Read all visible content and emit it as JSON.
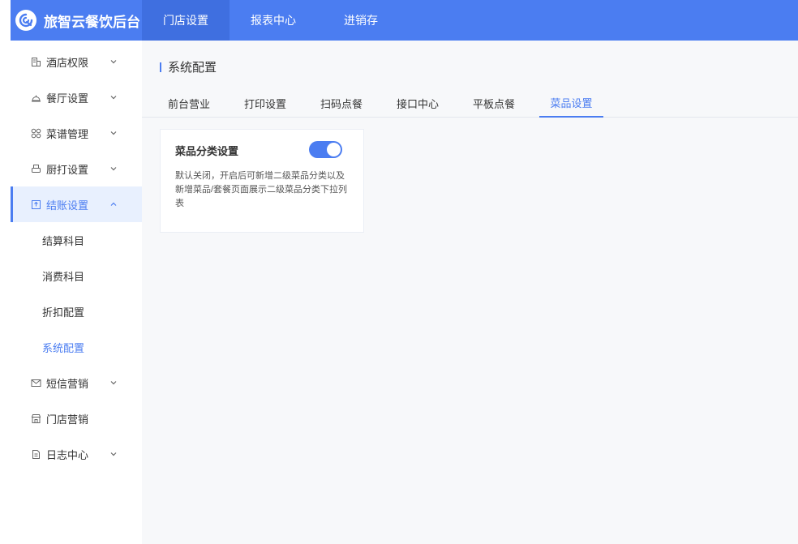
{
  "brand": {
    "name": "旅智云餐饮后台",
    "logo_icon": "swirl-logo"
  },
  "colors": {
    "primary": "#4b7df1",
    "primary_dark": "#3f6fe0",
    "sidebar_active_bg": "#e8f0fe",
    "content_bg": "#f7f8fa"
  },
  "topnav": [
    {
      "label": "门店设置",
      "active": true
    },
    {
      "label": "报表中心",
      "active": false
    },
    {
      "label": "进销存",
      "active": false
    }
  ],
  "sidebar": {
    "items": [
      {
        "label": "酒店权限",
        "icon": "building-icon",
        "expandable": true
      },
      {
        "label": "餐厅设置",
        "icon": "cloche-icon",
        "expandable": true
      },
      {
        "label": "菜谱管理",
        "icon": "grid-icon",
        "expandable": true
      },
      {
        "label": "厨打设置",
        "icon": "printer-icon",
        "expandable": true
      },
      {
        "label": "结账设置",
        "icon": "receipt-icon",
        "expandable": true,
        "open": true,
        "children": [
          {
            "label": "结算科目",
            "active": false
          },
          {
            "label": "消费科目",
            "active": false
          },
          {
            "label": "折扣配置",
            "active": false
          },
          {
            "label": "系统配置",
            "active": true
          }
        ]
      },
      {
        "label": "短信营销",
        "icon": "mail-icon",
        "expandable": true
      },
      {
        "label": "门店营销",
        "icon": "store-icon",
        "expandable": false
      },
      {
        "label": "日志中心",
        "icon": "document-icon",
        "expandable": true
      }
    ]
  },
  "page": {
    "title": "系统配置",
    "tabs": [
      {
        "label": "前台营业",
        "active": false
      },
      {
        "label": "打印设置",
        "active": false
      },
      {
        "label": "扫码点餐",
        "active": false
      },
      {
        "label": "接口中心",
        "active": false
      },
      {
        "label": "平板点餐",
        "active": false
      },
      {
        "label": "菜品设置",
        "active": true
      }
    ],
    "card": {
      "title": "菜品分类设置",
      "toggle_on": true,
      "description": "默认关闭，开启后可新增二级菜品分类以及新增菜品/套餐页面展示二级菜品分类下拉列表"
    }
  }
}
